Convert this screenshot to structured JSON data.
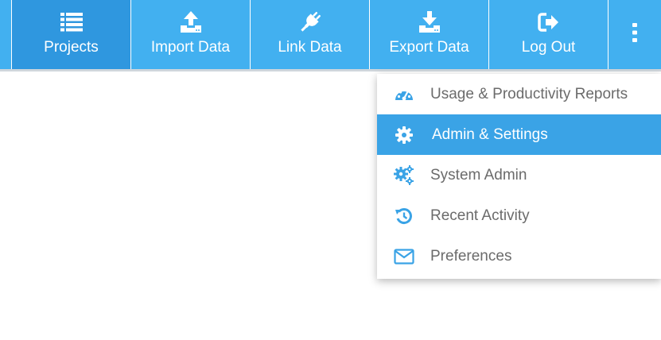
{
  "nav": {
    "items": [
      {
        "label": "Projects",
        "icon": "list-icon",
        "active": true
      },
      {
        "label": "Import Data",
        "icon": "upload-icon",
        "active": false
      },
      {
        "label": "Link Data",
        "icon": "plug-icon",
        "active": false
      },
      {
        "label": "Export Data",
        "icon": "download-icon",
        "active": false
      },
      {
        "label": "Log Out",
        "icon": "sign-out-icon",
        "active": false
      }
    ],
    "more_icon": "vertical-ellipsis-icon"
  },
  "menu": {
    "items": [
      {
        "label": "Usage & Productivity Reports",
        "icon": "dashboard-gauge-icon",
        "selected": false
      },
      {
        "label": "Admin & Settings",
        "icon": "gear-icon",
        "selected": true
      },
      {
        "label": "System Admin",
        "icon": "gears-icon",
        "selected": false
      },
      {
        "label": "Recent Activity",
        "icon": "history-icon",
        "selected": false
      },
      {
        "label": "Preferences",
        "icon": "envelope-icon",
        "selected": false
      }
    ]
  },
  "colors": {
    "topbar": "#42b0f0",
    "topbar_active": "#2f97df",
    "menu_selected": "#3aa3e6",
    "menu_text": "#6b6b6b",
    "menu_icon": "#3aa3e6"
  }
}
